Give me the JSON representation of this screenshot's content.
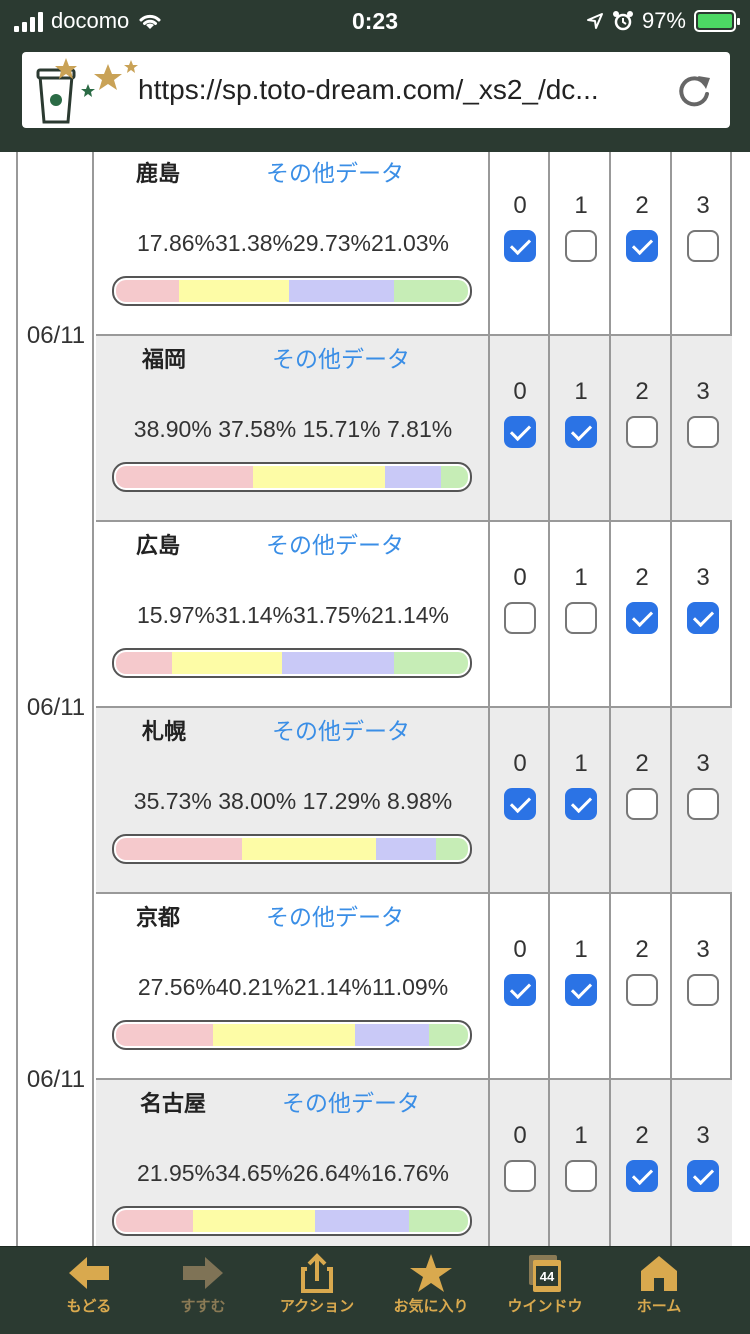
{
  "status_bar": {
    "carrier": "docomo",
    "time": "0:23",
    "battery": "97%"
  },
  "browser": {
    "url": "https://sp.toto-dream.com/_xs2_/dc..."
  },
  "colors": {
    "home": "#f5c9cc",
    "draw": "#fdfca6",
    "away": "#c9c9f7",
    "extra": "#c6edb6",
    "checked": "#2b73e5",
    "link": "#3a8ee6"
  },
  "choice_labels": [
    "0",
    "1",
    "2",
    "3"
  ],
  "groups": [
    {
      "date": "06/11",
      "matches": [
        {
          "team": "鹿島",
          "more": "その他データ",
          "pct_text": "17.86%31.38%29.73%21.03%",
          "fractions": [
            17.86,
            31.38,
            29.73,
            21.03
          ],
          "checked": [
            true,
            false,
            true,
            false
          ]
        },
        {
          "team": "福岡",
          "more": "その他データ",
          "pct_text": "38.90% 37.58% 15.71% 7.81%",
          "fractions": [
            38.9,
            37.58,
            15.71,
            7.81
          ],
          "checked": [
            true,
            true,
            false,
            false
          ]
        }
      ]
    },
    {
      "date": "06/11",
      "matches": [
        {
          "team": "広島",
          "more": "その他データ",
          "pct_text": "15.97%31.14%31.75%21.14%",
          "fractions": [
            15.97,
            31.14,
            31.75,
            21.14
          ],
          "checked": [
            false,
            false,
            true,
            true
          ]
        },
        {
          "team": "札幌",
          "more": "その他データ",
          "pct_text": "35.73% 38.00% 17.29% 8.98%",
          "fractions": [
            35.73,
            38.0,
            17.29,
            8.98
          ],
          "checked": [
            true,
            true,
            false,
            false
          ]
        }
      ]
    },
    {
      "date": "06/11",
      "matches": [
        {
          "team": "京都",
          "more": "その他データ",
          "pct_text": "27.56%40.21%21.14%11.09%",
          "fractions": [
            27.56,
            40.21,
            21.14,
            11.09
          ],
          "checked": [
            true,
            true,
            false,
            false
          ]
        },
        {
          "team": "名古屋",
          "more": "その他データ",
          "pct_text": "21.95%34.65%26.64%16.76%",
          "fractions": [
            21.95,
            34.65,
            26.64,
            16.76
          ],
          "checked": [
            false,
            false,
            true,
            true
          ]
        }
      ]
    }
  ],
  "toolbar": {
    "back": "もどる",
    "forward": "すすむ",
    "action": "アクション",
    "favorites": "お気に入り",
    "windows": "ウインドウ",
    "window_count": "44",
    "home": "ホーム"
  }
}
